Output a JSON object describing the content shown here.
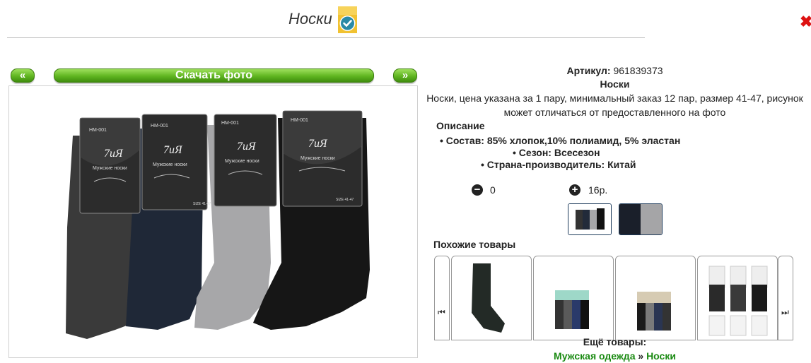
{
  "page": {
    "title": "Носки",
    "close_glyph": "✖"
  },
  "gallery": {
    "prev_label": "«",
    "next_label": "»",
    "download_label": "Скачать фото",
    "pack_label_code": "HM-001",
    "pack_brand": "7иЯ",
    "pack_text": "Мужские носки",
    "pack_size": "SIZE 41-47"
  },
  "product": {
    "article_label": "Артикул:",
    "article_value": "961839373",
    "name": "Носки",
    "description": "Носки, цена указана за 1 пару, минимальный заказ 12 пар, размер 41-47, рисунок может отличаться от предоставленного на фото",
    "desc_title": "Описание",
    "specs": [
      "Состав: 85% хлопок,10% полиамид, 5% эластан",
      "Сезон: Всесезон",
      "Страна-производитель: Китай"
    ]
  },
  "order": {
    "minus_glyph": "−",
    "plus_glyph": "+",
    "quantity": "0",
    "price": "16р."
  },
  "similar": {
    "title": "Похожие товары",
    "left_arrow": "⏮",
    "right_arrow": "⏭"
  },
  "more": {
    "label": "Ещё товары:",
    "crumb1": "Мужская одежда",
    "sep": "»",
    "crumb2": "Носки"
  },
  "colors": {
    "accent_green": "#5fb520",
    "link_green": "#1a8a12"
  }
}
